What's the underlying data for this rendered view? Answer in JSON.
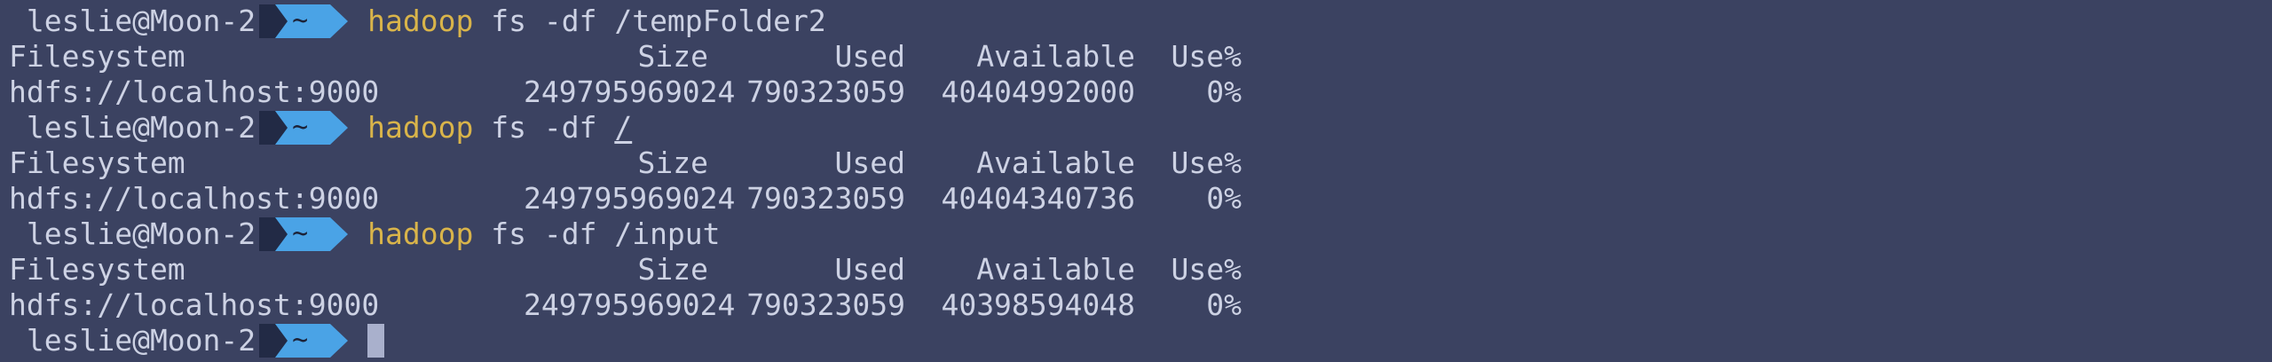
{
  "colors": {
    "background": "#3b4261",
    "text": "#cdd2e4",
    "command": "#d9b44a",
    "prompt_segment_dark": "#222a45",
    "prompt_segment_blue": "#4aa3e6"
  },
  "prompt": {
    "user_host": " leslie@Moon-2",
    "dir": "~"
  },
  "blocks": [
    {
      "command": {
        "name": "hadoop",
        "args_prefix": " fs -df ",
        "path": "/tempFolder2"
      },
      "header": [
        "Filesystem",
        "Size",
        "Used",
        "Available",
        "Use%"
      ],
      "row": [
        "hdfs://localhost:9000",
        "249795969024",
        "790323059",
        "40404992000",
        "0%"
      ]
    },
    {
      "command": {
        "name": "hadoop",
        "args_prefix": " fs -df ",
        "path": "/"
      },
      "header": [
        "Filesystem",
        "Size",
        "Used",
        "Available",
        "Use%"
      ],
      "row": [
        "hdfs://localhost:9000",
        "249795969024",
        "790323059",
        "40404340736",
        "0%"
      ]
    },
    {
      "command": {
        "name": "hadoop",
        "args_prefix": " fs -df ",
        "path": "/input"
      },
      "header": [
        "Filesystem",
        "Size",
        "Used",
        "Available",
        "Use%"
      ],
      "row": [
        "hdfs://localhost:9000",
        "249795969024",
        "790323059",
        "40398594048",
        "0%"
      ]
    }
  ]
}
